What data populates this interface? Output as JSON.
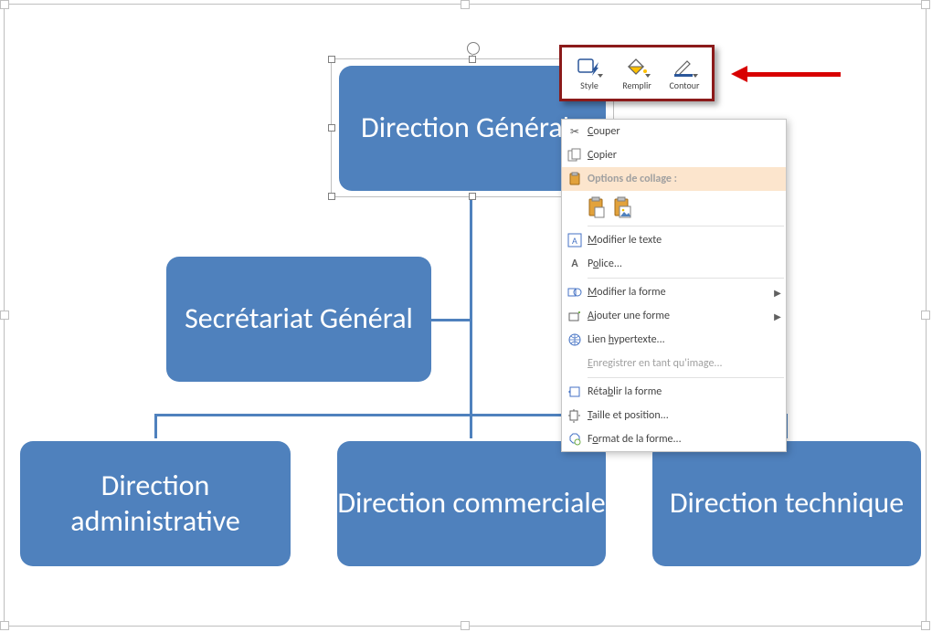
{
  "nodes": {
    "dg": "Direction Générale",
    "sg": "Secrétariat Général",
    "da": "Direction administrative",
    "dc": "Direction commerciale",
    "dt": "Direction technique"
  },
  "toolbar": {
    "style": "Style",
    "fill": "Remplir",
    "outline": "Contour"
  },
  "ctx": {
    "cut": "Couper",
    "copy": "Copier",
    "paste_opts": "Options de collage :",
    "edit_text": "Modifier le texte",
    "font": "Police...",
    "change_shape": "Modifier la forme",
    "add_shape": "Ajouter une forme",
    "hyperlink": "Lien hypertexte...",
    "save_img": "Enregistrer en tant qu'image...",
    "reset": "Rétablir la forme",
    "size_pos": "Taille et position...",
    "format": "Format de la forme..."
  },
  "underline": {
    "cut": "C",
    "copy": "C",
    "edit_text": "M",
    "font": "o",
    "change_shape": "M",
    "add_shape": "A",
    "hyperlink": "h",
    "save_img": "E",
    "reset": "b",
    "size_pos": "T",
    "format": "o"
  }
}
